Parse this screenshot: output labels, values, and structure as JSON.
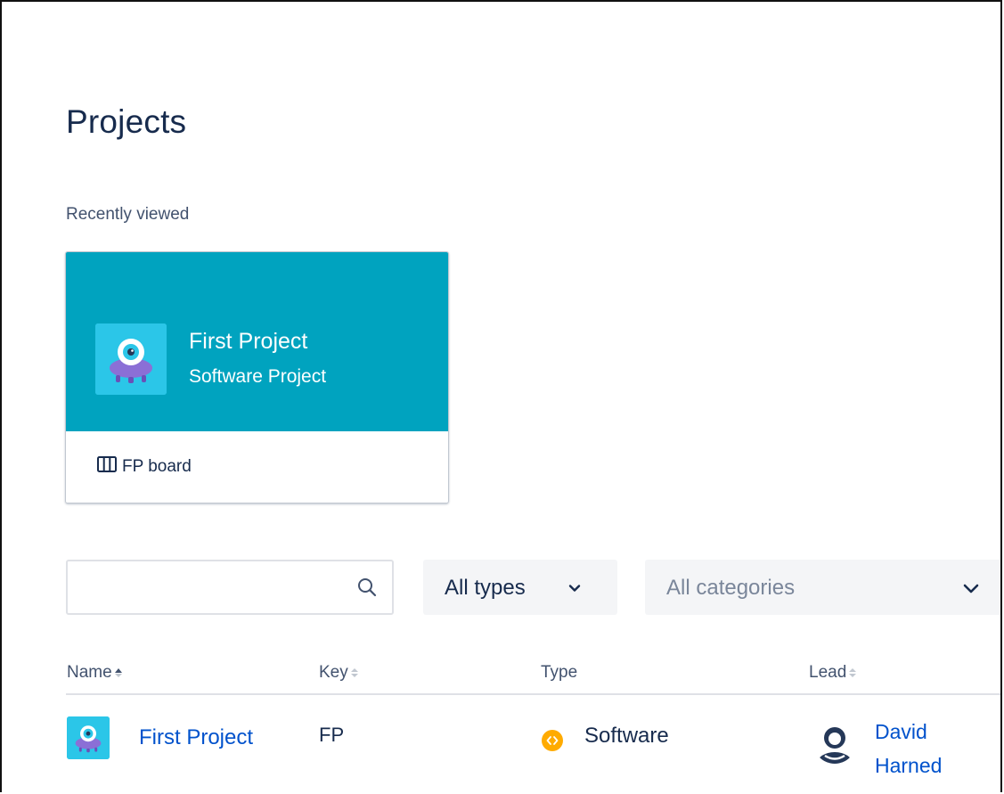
{
  "page": {
    "title": "Projects",
    "recent_label": "Recently viewed"
  },
  "recent_card": {
    "title": "First Project",
    "subtitle": "Software Project",
    "board_label": "FP board",
    "header_color": "#00a3bf"
  },
  "filters": {
    "search_value": "",
    "search_placeholder": "",
    "types_selected": "All types",
    "categories_placeholder": "All categories"
  },
  "table": {
    "headers": {
      "name": "Name",
      "key": "Key",
      "type": "Type",
      "lead": "Lead"
    },
    "rows": [
      {
        "name": "First Project",
        "key": "FP",
        "type": "Software",
        "lead": "David Harned"
      }
    ]
  },
  "colors": {
    "link": "#0052cc",
    "software_badge": "#ffab00",
    "avatar_bg": "#26c6e6"
  }
}
